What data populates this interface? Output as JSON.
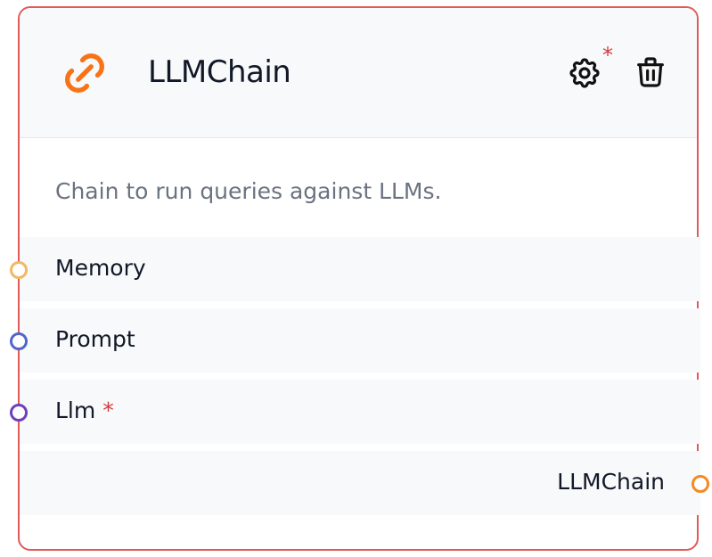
{
  "node": {
    "title": "LLMChain",
    "description": "Chain to run queries against LLMs.",
    "settings_required_marker": "*",
    "icons": {
      "node": "chain-link-icon",
      "settings": "gear-icon",
      "delete": "trash-icon"
    },
    "colors": {
      "border": "#e05a5a",
      "accent": "#f97316",
      "required": "#d33b3b"
    },
    "inputs": [
      {
        "label": "Memory",
        "required": false,
        "handle_color": "#f0b963"
      },
      {
        "label": "Prompt",
        "required": false,
        "handle_color": "#4f67c9"
      },
      {
        "label": "Llm",
        "required": true,
        "required_marker": "*",
        "handle_color": "#6d3fbd"
      }
    ],
    "output": {
      "label": "LLMChain",
      "handle_color": "#f58a1f"
    }
  }
}
